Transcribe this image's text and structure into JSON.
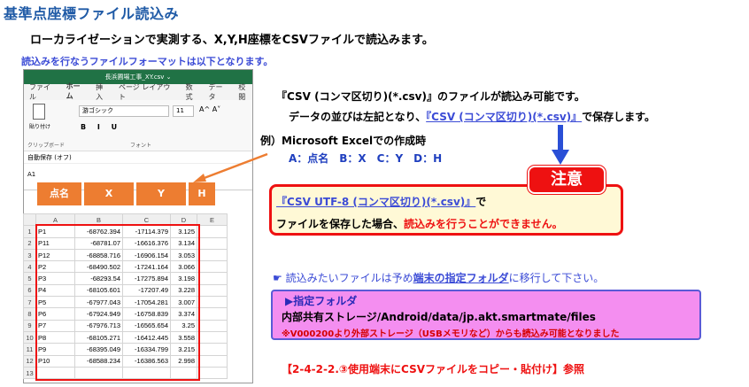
{
  "heading": {
    "title": "基準点座標ファイル読込み",
    "subtitle": "ローカライゼーションで実測する、X,Y,H座標をCSVファイルで読込みます。",
    "format_note": "読込みを行なうファイルフォーマットは以下となります。"
  },
  "excel": {
    "window_title": "長浜圃場工事_XY.csv ⌄",
    "tabs": [
      "ファイル",
      "ホーム",
      "挿入",
      "ページ レイアウト",
      "数式",
      "データ",
      "校閲"
    ],
    "paste_label": "貼り付け",
    "font_name": "游ゴシック",
    "font_size": "11",
    "font_grow": "A^ A˅",
    "format_buttons": "B I U",
    "group_clipboard": "クリップボード",
    "group_font": "フォント",
    "autosave": "自動保存 (オフ)",
    "cell_ref": "A1",
    "overlay_headers": [
      "点名",
      "X",
      "Y",
      "H"
    ],
    "columns": [
      "",
      "A",
      "B",
      "C",
      "D",
      "E"
    ],
    "rows": [
      [
        "1",
        "P1",
        "-68762.394",
        "-17114.379",
        "3.125"
      ],
      [
        "2",
        "P11",
        "-68781.07",
        "-16616.376",
        "3.134"
      ],
      [
        "3",
        "P12",
        "-68858.716",
        "-16906.154",
        "3.053"
      ],
      [
        "4",
        "P2",
        "-68490.502",
        "-17241.164",
        "3.066"
      ],
      [
        "5",
        "P3",
        "-68293.54",
        "-17275.894",
        "3.198"
      ],
      [
        "6",
        "P4",
        "-68105.601",
        "-17207.49",
        "3.228"
      ],
      [
        "7",
        "P5",
        "-67977.043",
        "-17054.281",
        "3.007"
      ],
      [
        "8",
        "P6",
        "-67924.949",
        "-16758.839",
        "3.374"
      ],
      [
        "9",
        "P7",
        "-67976.713",
        "-16565.654",
        "3.25"
      ],
      [
        "10",
        "P8",
        "-68105.271",
        "-16412.445",
        "3.558"
      ],
      [
        "11",
        "P9",
        "-68395.049",
        "-16334.799",
        "3.215"
      ],
      [
        "12",
        "P10",
        "-68588.234",
        "-16386.563",
        "2.998"
      ],
      [
        "13",
        "",
        "",
        "",
        ""
      ]
    ]
  },
  "info": {
    "line1": "『CSV (コンマ区切り)(*.csv)』のファイルが読込み可能です。",
    "line2_prefix": "データの並びは左記となり、",
    "line2_link": "『CSV (コンマ区切り)(*.csv)』",
    "line2_suffix": "で保存します。",
    "example": "例）Microsoft Excelでの作成時",
    "columns_map": "A：点名　B：X　C：Y　D：H"
  },
  "warning": {
    "badge": "注意",
    "line1_link": "『CSV UTF-8 (コンマ区切り)(*.csv)』",
    "line1_suffix": "で",
    "line2_prefix": "ファイルを保存した場合、",
    "line2_red": "読込みを行うことができません。"
  },
  "move": {
    "bullet": "☛",
    "prefix": "読込みたいファイルは予め",
    "link": "端末の指定フォルダ",
    "suffix": "に移行して下さい。"
  },
  "folder": {
    "label": "▶指定フォルダ",
    "path": "内部共有ストレージ/Android/data/jp.akt.smartmate/files",
    "note": "※V000200より外部ストレージ（USBメモリなど）からも読込み可能となりました"
  },
  "reference": "【2-4-2-2.③使用端末にCSVファイルをコピー・貼付け】参照",
  "colors": {
    "accent_orange": "#ed7d31",
    "excel_green": "#207245",
    "warning_red": "#e11111",
    "folder_pink": "#f48ef0",
    "link_blue": "#3b4bd6"
  }
}
